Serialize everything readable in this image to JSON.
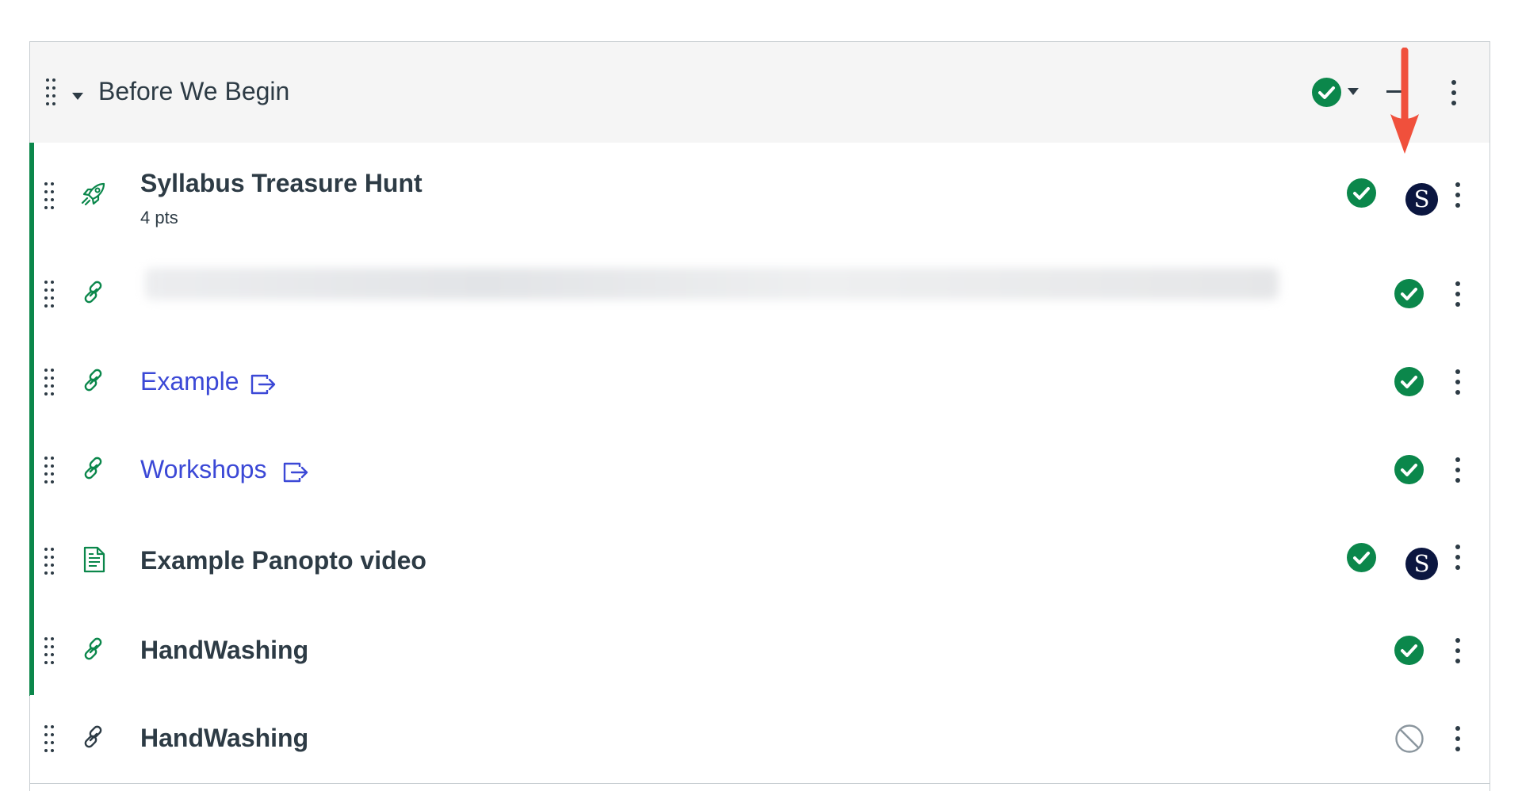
{
  "module": {
    "title": "Before We Begin",
    "status": "published"
  },
  "items": [
    {
      "type": "quiz",
      "icon": "rocket-icon",
      "title": "Syllabus Treasure Hunt",
      "subtitle": "4 pts",
      "status": "published",
      "avatar": "S"
    },
    {
      "type": "link",
      "icon": "link-icon",
      "title": "",
      "blurred": true,
      "status": "published"
    },
    {
      "type": "link",
      "icon": "link-icon",
      "title": "Example",
      "external": true,
      "status": "published"
    },
    {
      "type": "link",
      "icon": "link-icon",
      "title": "Workshops",
      "external": true,
      "status": "published"
    },
    {
      "type": "page",
      "icon": "document-icon",
      "title": "Example Panopto video",
      "status": "published",
      "avatar": "S"
    },
    {
      "type": "link",
      "icon": "link-icon",
      "title": "HandWashing",
      "status": "published"
    },
    {
      "type": "link",
      "icon": "link-icon",
      "title": "HandWashing",
      "status": "unpublished"
    }
  ],
  "colors": {
    "published": "#0b874b",
    "link": "#3b48d6",
    "text": "#2d3b45",
    "avatar": "#0b1640",
    "annotation_arrow": "#f0503c"
  }
}
